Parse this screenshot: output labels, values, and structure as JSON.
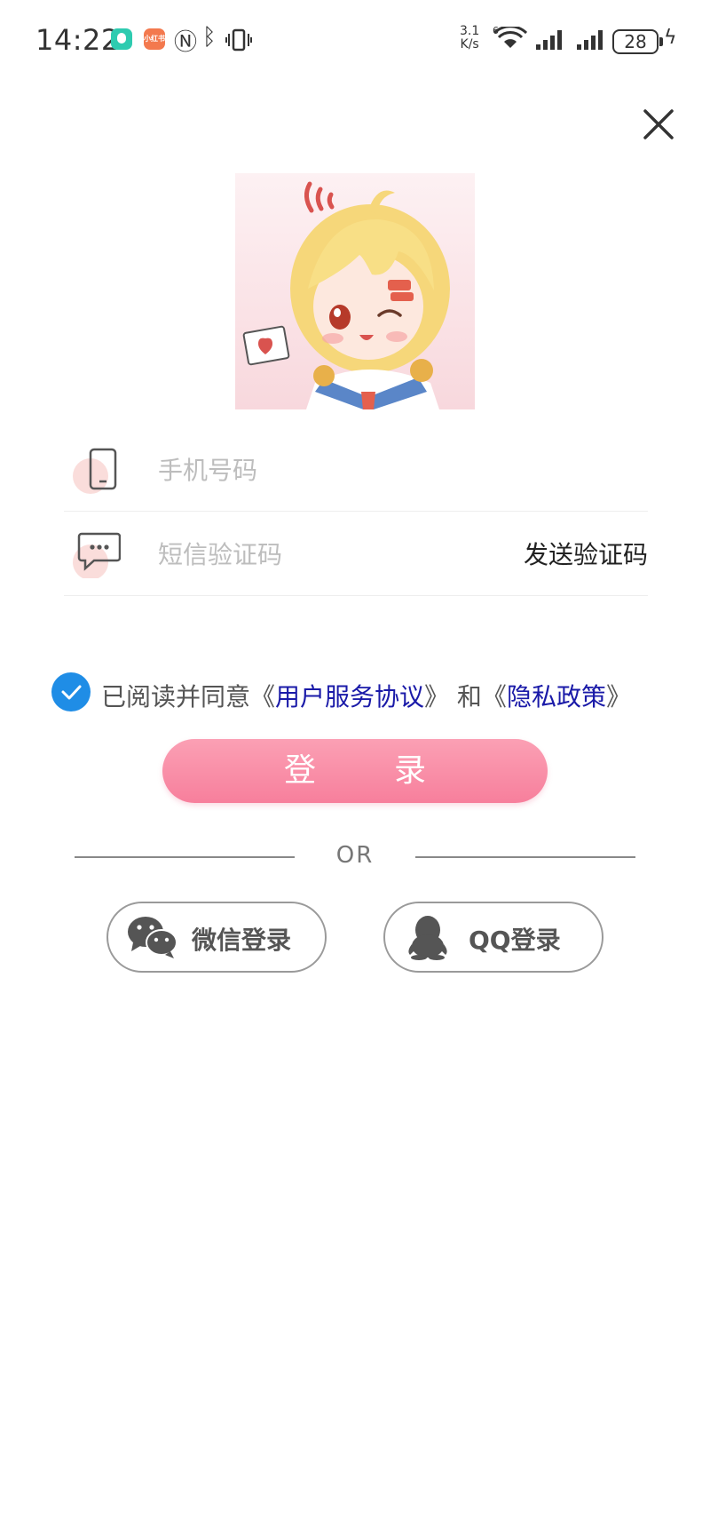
{
  "status_bar": {
    "time": "14:22",
    "net_speed_value": "3.1",
    "net_speed_unit": "K/s",
    "wifi_badge": "6",
    "battery": "28",
    "app_icon_2_text": "小红书"
  },
  "form": {
    "phone_placeholder": "手机号码",
    "sms_placeholder": "短信验证码",
    "send_code_label": "发送验证码"
  },
  "agreement": {
    "checked": true,
    "prefix": "已阅读并同意《",
    "terms_link": "用户服务协议",
    "middle": "》 和《",
    "privacy_link": "隐私政策",
    "suffix": "》"
  },
  "login_button_label": "登录",
  "divider_text": "OR",
  "social": {
    "wechat_label": "微信登录",
    "qq_label": "QQ登录"
  },
  "colors": {
    "accent_pink": "#f77f9c",
    "checkbox_blue": "#1f8de6",
    "link_blue": "#1a1aa8"
  },
  "icons": [
    "close-icon",
    "phone-icon",
    "message-icon",
    "check-icon",
    "wechat-icon",
    "qq-icon"
  ]
}
